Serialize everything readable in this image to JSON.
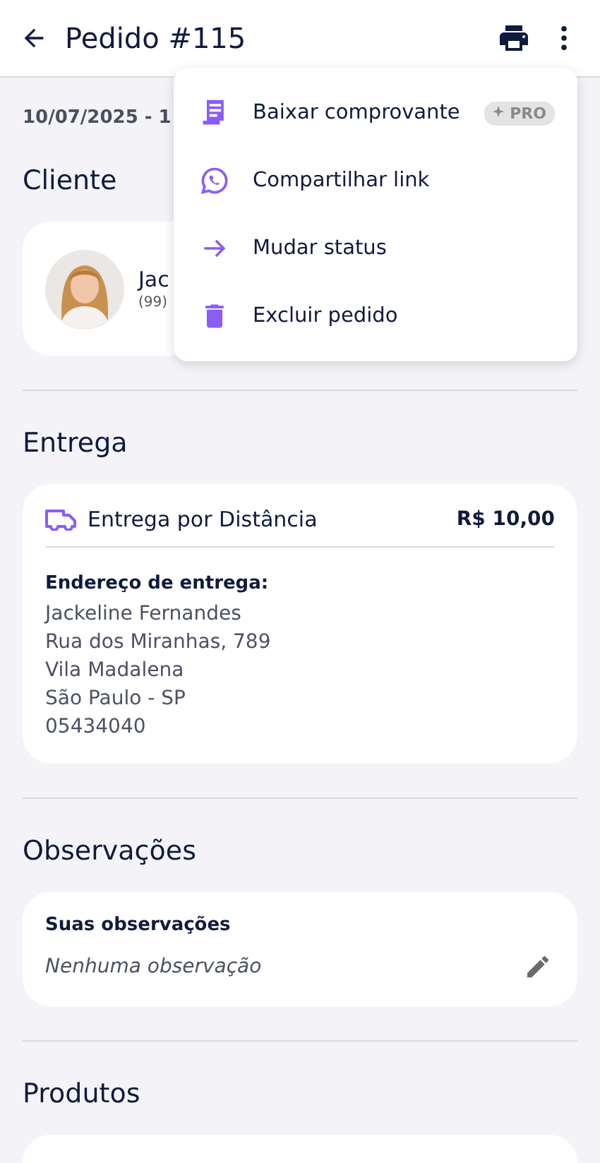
{
  "header": {
    "title": "Pedido #115"
  },
  "order_date": "10/07/2025 - 1",
  "client": {
    "heading": "Cliente",
    "name": "Jac",
    "phone": "(99)"
  },
  "delivery": {
    "heading": "Entrega",
    "method": "Entrega por Distância",
    "price": "R$ 10,00",
    "address_label": "Endereço de entrega:",
    "address_lines": [
      "Jackeline Fernandes",
      "Rua dos Miranhas, 789",
      "Vila Madalena",
      "São Paulo - SP",
      "05434040"
    ]
  },
  "notes": {
    "heading": "Observações",
    "label": "Suas observações",
    "text": "Nenhuma observação"
  },
  "products": {
    "heading": "Produtos"
  },
  "menu": {
    "open": true,
    "items": [
      {
        "kind": "receipt",
        "label": "Baixar comprovante",
        "badge": "PRO"
      },
      {
        "kind": "share",
        "label": "Compartilhar link"
      },
      {
        "kind": "status",
        "label": "Mudar status"
      },
      {
        "kind": "delete",
        "label": "Excluir pedido"
      }
    ]
  }
}
